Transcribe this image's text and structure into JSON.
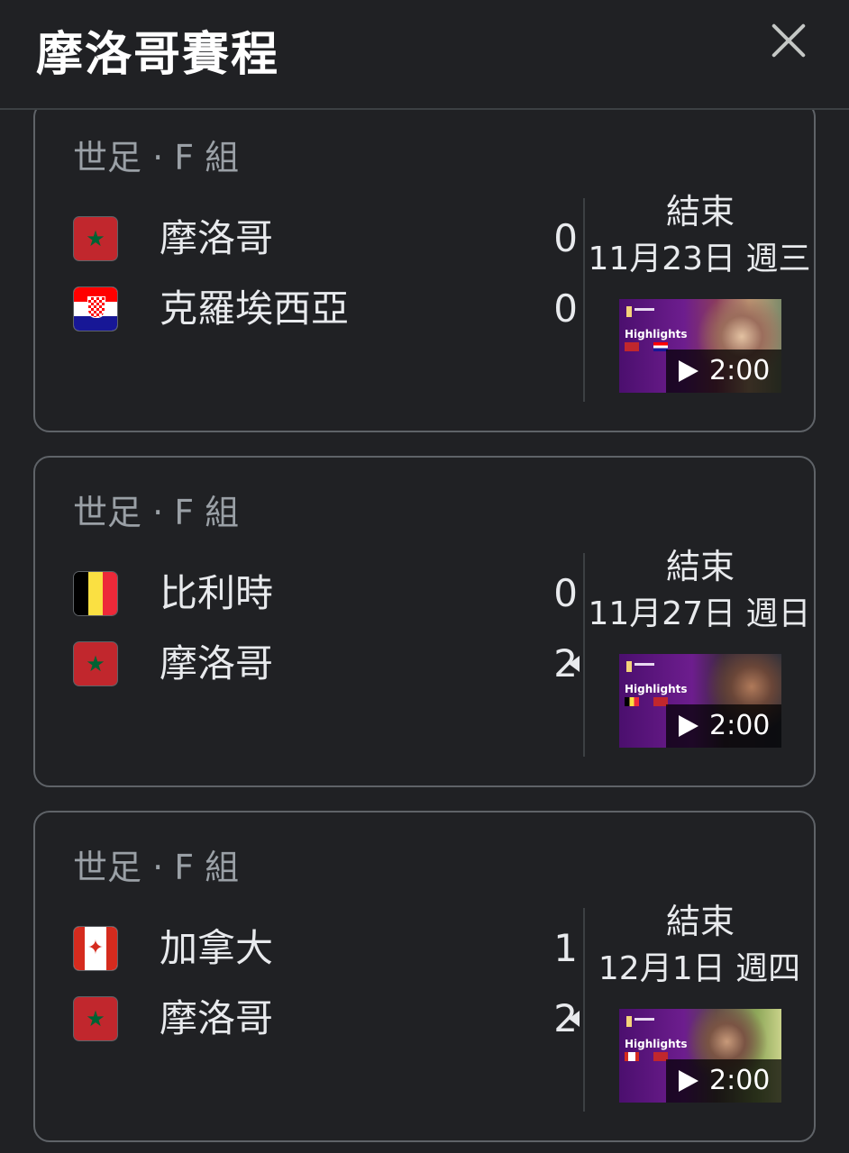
{
  "header": {
    "title": "摩洛哥賽程",
    "close_label": "close"
  },
  "matches": [
    {
      "league": "世足 · F 組",
      "teams": [
        {
          "name": "摩洛哥",
          "score": "0",
          "flag": "morocco"
        },
        {
          "name": "克羅埃西亞",
          "score": "0",
          "flag": "croatia"
        }
      ],
      "status": "結束",
      "date": "11月23日 週三",
      "video": {
        "label": "Highlights",
        "duration": "2:00"
      }
    },
    {
      "league": "世足 · F 組",
      "teams": [
        {
          "name": "比利時",
          "score": "0",
          "flag": "belgium"
        },
        {
          "name": "摩洛哥",
          "score": "2",
          "flag": "morocco",
          "winner": true
        }
      ],
      "status": "結束",
      "date": "11月27日 週日",
      "video": {
        "label": "Highlights",
        "duration": "2:00"
      }
    },
    {
      "league": "世足 · F 組",
      "teams": [
        {
          "name": "加拿大",
          "score": "1",
          "flag": "canada"
        },
        {
          "name": "摩洛哥",
          "score": "2",
          "flag": "morocco",
          "winner": true
        }
      ],
      "status": "結束",
      "date": "12月1日 週四",
      "video": {
        "label": "Highlights",
        "duration": "2:00"
      }
    }
  ],
  "colors": {
    "background": "#202124",
    "border": "#5f6368",
    "text": "#e8eaed",
    "muted": "#9aa0a6"
  },
  "icons": {
    "close": "close-icon",
    "play": "play-icon",
    "winner": "winner-arrow-icon"
  }
}
